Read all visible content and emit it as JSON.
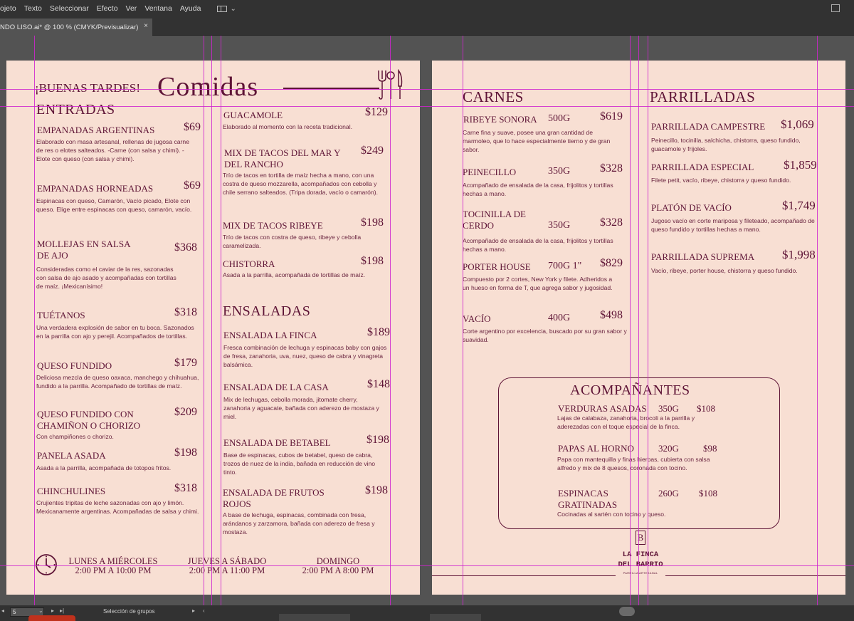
{
  "menubar": {
    "items": [
      "ojeto",
      "Texto",
      "Seleccionar",
      "Efecto",
      "Ver",
      "Ventana",
      "Ayuda"
    ]
  },
  "tab": {
    "title": "NDO LISO.ai* @ 100 % (CMYK/Previsualizar)",
    "close": "×"
  },
  "page1": {
    "greeting": "¡BUENAS TARDES!",
    "title": "Comidas",
    "entradas": {
      "heading": "ENTRADAS",
      "items": [
        {
          "name": "EMPANADAS ARGENTINAS",
          "price": "$69",
          "desc": "Elaborado con masa artesanal, rellenas de jugosa carne de res o elotes salteados. -Carne (con salsa y chimi). -Elote con queso (con salsa y chimi)."
        },
        {
          "name": "EMPANADAS HORNEADAS",
          "price": "$69",
          "desc": "Espinacas con queso, Camarón, Vacío picado, Elote con queso. Elige entre espinacas con queso, camarón, vacío."
        },
        {
          "name1": "MOLLEJAS EN SALSA",
          "name2": "DE AJO",
          "price": "$368",
          "desc": "Consideradas como el caviar de la res, sazonadas con salsa de ajo asado y acompañadas con tortillas de maíz. ¡Mexicanísimo!"
        },
        {
          "name": "TUÉTANOS",
          "price": "$318",
          "desc": "Una verdadera explosión de sabor en tu boca. Sazonados en la parrilla con ajo y perejil. Acompañados de tortillas."
        },
        {
          "name": "QUESO FUNDIDO",
          "price": "$179",
          "desc": "Deliciosa mezcla de queso oaxaca, manchego y chihuahua, fundido a la parrilla. Acompañado de tortillas de maíz."
        },
        {
          "name1": "QUESO FUNDIDO CON",
          "name2": "CHAMIÑON O CHORIZO",
          "price": "$209",
          "desc": "Con champiñones o chorizo."
        },
        {
          "name": "PANELA ASADA",
          "price": "$198",
          "desc": "Asada a la parrilla, acompañada de totopos fritos."
        },
        {
          "name": "CHINCHULINES",
          "price": "$318",
          "desc": "Crujientes tripitas de leche sazonadas con ajo y limón. Mexicanamente argentinas. Acompañadas de salsa y chimi."
        }
      ]
    },
    "col2": [
      {
        "name": "GUACAMOLE",
        "price": "$129",
        "desc": "Elaborado al momento con la receta tradicional."
      },
      {
        "name1": "MIX DE TACOS DEL MAR Y",
        "name2": "DEL RANCHO",
        "price": "$249",
        "desc": "Trío de tacos en tortilla de maíz hecha a mano, con una costra de queso mozzarella, acompañados con cebolla y chile serrano salteados. (Tripa dorada, vacío o camarón)."
      },
      {
        "name": "MIX DE TACOS RIBEYE",
        "price": "$198",
        "desc": "Trío de tacos con costra de queso, ribeye y cebolla caramelizada."
      },
      {
        "name": "CHISTORRA",
        "price": "$198",
        "desc": "Asada a la parrilla, acompañada de tortillas de maíz."
      }
    ],
    "ensaladas": {
      "heading": "ENSALADAS",
      "items": [
        {
          "name": "ENSALADA LA FINCA",
          "price": "$189",
          "desc": "Fresca combinación de lechuga y espinacas baby con gajos de fresa, zanahoria, uva, nuez, queso de cabra y vinagreta balsámica."
        },
        {
          "name": "ENSALADA DE LA CASA",
          "price": "$148",
          "desc": "Mix de lechugas, cebolla morada, jitomate cherry, zanahoria y aguacate, bañada con aderezo de mostaza y miel."
        },
        {
          "name": "ENSALADA DE BETABEL",
          "price": "$198",
          "desc": "Base de espinacas, cubos de betabel, queso de cabra, trozos de nuez de la india, bañada en reducción de vino tinto."
        },
        {
          "name1": "ENSALADA DE FRUTOS",
          "name2": "ROJOS",
          "price": "$198",
          "desc": "A base de lechuga, espinacas, combinada con fresa, arándanos y zarzamora, bañada con aderezo de fresa y mostaza."
        }
      ]
    },
    "hours": [
      {
        "days": "LUNES A MIÉRCOLES",
        "time": "2:00 PM A 10:00 PM"
      },
      {
        "days": "JUEVES A SÁBADO",
        "time": "2:00 PM A 11:00 PM"
      },
      {
        "days": "DOMINGO",
        "time": "2:00 PM A 8:00 PM"
      }
    ]
  },
  "page2": {
    "carnes": {
      "heading": "CARNES",
      "items": [
        {
          "name": "RIBEYE SONORA",
          "weight": "500G",
          "price": "$619",
          "desc": "Carne fina y suave, posee una gran cantidad de marmoleo, que lo hace especialmente tierno y de gran sabor."
        },
        {
          "name": "PEINECILLO",
          "weight": "350G",
          "price": "$328",
          "desc": "Acompañado de ensalada de la casa, frijolitos y tortillas hechas a mano."
        },
        {
          "name1": "TOCINILLA DE",
          "name2": "CERDO",
          "weight": "350G",
          "price": "$328",
          "desc": "Acompañado de ensalada de la casa, frijolitos y tortillas hechas a mano."
        },
        {
          "name": "PORTER HOUSE",
          "weight": "700G 1\"",
          "price": "$829",
          "desc": "Compuesto por 2 cortes, New York y filete. Adheridos a un hueso en forma de T, que agrega sabor y jugosidad."
        },
        {
          "name": "VACÍO",
          "weight": "400G",
          "price": "$498",
          "desc": "Corte argentino por excelencia, buscado por su gran sabor y suavidad."
        }
      ]
    },
    "parrilladas": {
      "heading": "PARRILLADAS",
      "items": [
        {
          "name": "PARRILLADA CAMPESTRE",
          "price": "$1,069",
          "desc": "Peinecillo, tocinilla, salchicha, chistorra, queso fundido, guacamole y frijoles."
        },
        {
          "name": "PARRILLADA ESPECIAL",
          "price": "$1,859",
          "desc": "Filete petit, vacío, ribeye, chistorra y queso fundido."
        },
        {
          "name": "PLATÓN DE VACÍO",
          "price": "$1,749",
          "desc": "Jugoso vacío en corte mariposa y fileteado, acompañado de queso fundido y tortillas hechas a mano."
        },
        {
          "name": "PARRILLADA SUPREMA",
          "price": "$1,998",
          "desc": "Vacío, ribeye, porter house, chistorra y queso fundido."
        }
      ]
    },
    "acomp": {
      "heading": "ACOMPAÑANTES",
      "items": [
        {
          "name": "VERDURAS ASADAS",
          "weight": "350G",
          "price": "$108",
          "desc": "Lajas de calabaza, zanahoria, brocoli a la parrilla y aderezadas con el toque especial de la finca."
        },
        {
          "name": "PAPAS AL HORNO",
          "weight": "320G",
          "price": "$98",
          "desc": "Papa con mantequilla y finas hierbas, cubierta con salsa alfredo y mix de 8 quesos, coronada con tocino."
        },
        {
          "name1": "ESPINACAS",
          "name2": "GRATINADAS",
          "weight": "260G",
          "price": "$108",
          "desc": "Cocinadas al sartén con tocino y queso."
        }
      ]
    },
    "logo": {
      "mark": "B",
      "line1": "LA FINCA",
      "line2": "DEL BARRIO",
      "sub": "PARRILLA ARTESANAL"
    }
  },
  "status": {
    "zoom": "5",
    "selection": "Selección de grupos"
  },
  "colors": {
    "accent": "#5e1436",
    "paper": "#f8dfd3",
    "guide": "#cf25cf",
    "chrome": "#323232",
    "pasteboard": "#535353"
  }
}
